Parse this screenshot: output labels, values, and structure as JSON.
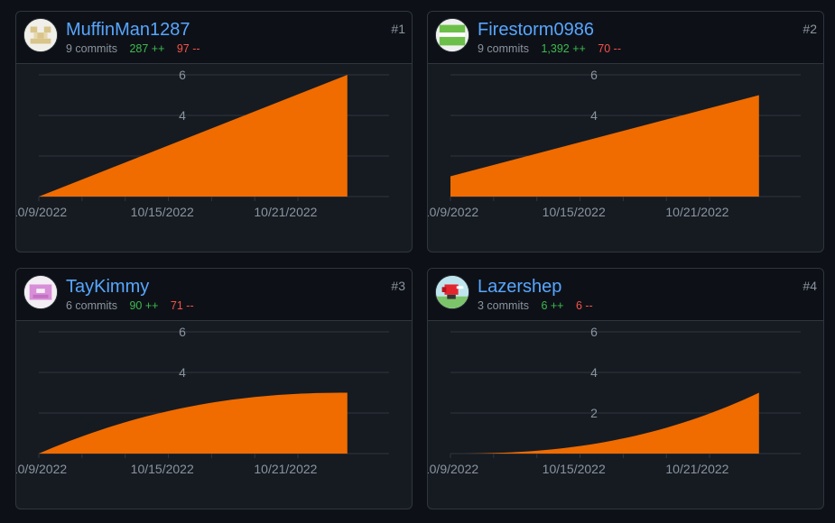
{
  "contributors": [
    {
      "rank": "#1",
      "username": "MuffinMan1287",
      "commits": "9 commits",
      "additions": "287 ++",
      "deletions": "97 --",
      "avatar_icon": "identicon-tan",
      "chart_data": {
        "type": "area",
        "x": [
          "2022-10-09",
          "2022-10-24"
        ],
        "y": [
          0,
          6
        ],
        "shape": "linear",
        "x_tick_labels": [
          "10/9/2022",
          "10/15/2022",
          "10/21/2022"
        ],
        "y_tick_labels": [
          "4",
          "6"
        ],
        "ylim": [
          0,
          6
        ],
        "fill_color": "#f06b00"
      }
    },
    {
      "rank": "#2",
      "username": "Firestorm0986",
      "commits": "9 commits",
      "additions": "1,392 ++",
      "deletions": "70 --",
      "avatar_icon": "identicon-green",
      "chart_data": {
        "type": "area",
        "x": [
          "2022-10-09",
          "2022-10-24"
        ],
        "y": [
          1,
          5
        ],
        "shape": "linear",
        "x_tick_labels": [
          "10/9/2022",
          "10/15/2022",
          "10/21/2022"
        ],
        "y_tick_labels": [
          "4",
          "6"
        ],
        "ylim": [
          0,
          6
        ],
        "fill_color": "#f06b00"
      }
    },
    {
      "rank": "#3",
      "username": "TayKimmy",
      "commits": "6 commits",
      "additions": "90 ++",
      "deletions": "71 --",
      "avatar_icon": "identicon-pink",
      "chart_data": {
        "type": "area",
        "x": [
          "2022-10-09",
          "2022-10-24"
        ],
        "y": [
          0,
          3
        ],
        "shape": "ease-out",
        "x_tick_labels": [
          "10/9/2022",
          "10/15/2022",
          "10/21/2022"
        ],
        "y_tick_labels": [
          "4",
          "6"
        ],
        "ylim": [
          0,
          6
        ],
        "fill_color": "#f06b00"
      }
    },
    {
      "rank": "#4",
      "username": "Lazershep",
      "commits": "3 commits",
      "additions": "6 ++",
      "deletions": "6 --",
      "avatar_icon": "avatar-image",
      "chart_data": {
        "type": "area",
        "x": [
          "2022-10-09",
          "2022-10-24"
        ],
        "y": [
          0,
          3
        ],
        "shape": "ease-in",
        "x_tick_labels": [
          "10/9/2022",
          "10/15/2022",
          "10/21/2022"
        ],
        "y_tick_labels": [
          "2",
          "4",
          "6"
        ],
        "ylim": [
          0,
          6
        ],
        "fill_color": "#f06b00"
      }
    }
  ]
}
